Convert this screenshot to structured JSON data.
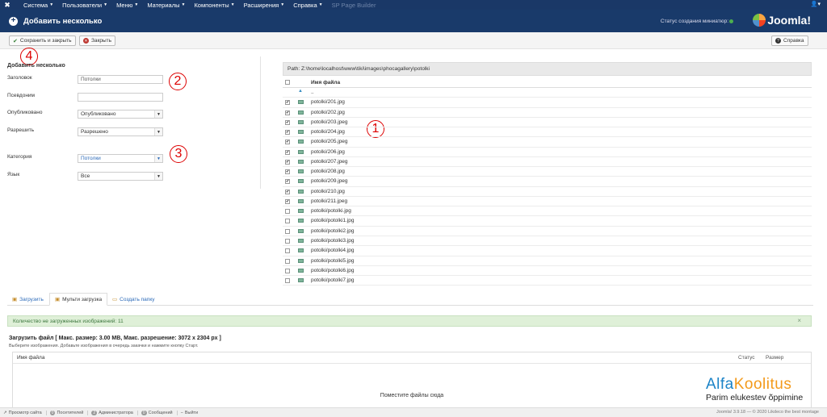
{
  "topnav": {
    "items": [
      "Система",
      "Пользователи",
      "Меню",
      "Материалы",
      "Компоненты",
      "Расширения",
      "Справка"
    ],
    "disabled_item": "SP Page Builder"
  },
  "header": {
    "title": "Добавить несколько",
    "status_text": "Статус создания миниатюр:",
    "brand": "Joomla!"
  },
  "toolbar": {
    "save_close": "Сохранить и закрыть",
    "close": "Закрыть",
    "help": "Справка"
  },
  "annotations": [
    "1",
    "2",
    "3",
    "4"
  ],
  "form": {
    "legend": "Добавить несколько",
    "title_label": "Заголовок",
    "title_value": "Потолки",
    "alias_label": "Псевдоним",
    "alias_value": "",
    "published_label": "Опубликовано",
    "published_value": "Опубликовано",
    "access_label": "Разрешить",
    "access_value": "Разрешено",
    "category_label": "Категория",
    "category_value": "Потолки",
    "language_label": "Язык",
    "language_value": "Все"
  },
  "files": {
    "path": "Path: Z:\\home\\localhost\\www\\tiki\\images\\phocagallery\\potolki",
    "header_name": "Имя файла",
    "up": "..",
    "items": [
      {
        "name": "potolki/201.jpg",
        "checked": true
      },
      {
        "name": "potolki/202.jpg",
        "checked": true
      },
      {
        "name": "potolki/203.jpeg",
        "checked": true
      },
      {
        "name": "potolki/204.jpg",
        "checked": true
      },
      {
        "name": "potolki/205.jpeg",
        "checked": true
      },
      {
        "name": "potolki/206.jpg",
        "checked": true
      },
      {
        "name": "potolki/207.jpeg",
        "checked": true
      },
      {
        "name": "potolki/208.jpg",
        "checked": true
      },
      {
        "name": "potolki/209.jpeg",
        "checked": true
      },
      {
        "name": "potolki/210.jpg",
        "checked": true
      },
      {
        "name": "potolki/211.jpeg",
        "checked": true
      },
      {
        "name": "potolki/potolki.jpg",
        "checked": false
      },
      {
        "name": "potolki/potolki1.jpg",
        "checked": false
      },
      {
        "name": "potolki/potolki2.jpg",
        "checked": false
      },
      {
        "name": "potolki/potolki3.jpg",
        "checked": false
      },
      {
        "name": "potolki/potolki4.jpg",
        "checked": false
      },
      {
        "name": "potolki/potolki5.jpg",
        "checked": false
      },
      {
        "name": "potolki/potolki6.jpg",
        "checked": false
      },
      {
        "name": "potolki/potolki7.jpg",
        "checked": false
      }
    ]
  },
  "tabs": [
    "Загрузить",
    "Мульти загрузка",
    "Создать папку"
  ],
  "alert": {
    "text": "Количество не загруженных изображений: 11",
    "close": "×"
  },
  "upload": {
    "title": "Загрузить файл [ Макс. размер: 3.00 MB, Макс. разрешение: 3072 x 2304 px ]",
    "hint": "Выберите изображения. Добавьте изображения в очередь закачки и нажмите кнопку Старт.",
    "col_name": "Имя файла",
    "col_status": "Статус",
    "col_size": "Размер",
    "drop": "Поместите файлы сюда"
  },
  "brand": {
    "part1": "Alfa",
    "part2": "Koolitus",
    "tagline": "Parim elukestev õppimine"
  },
  "footer": {
    "view_site": "Просмотр сайта",
    "visitors_count": "0",
    "visitors": "Посетителей",
    "admins_count": "2",
    "admins": "Администратора",
    "messages_count": "0",
    "messages": "Сообщений",
    "logout": "Выйти",
    "copyright": "Joomla! 3.9.18  —  © 2020 Likdeco the best montage"
  }
}
